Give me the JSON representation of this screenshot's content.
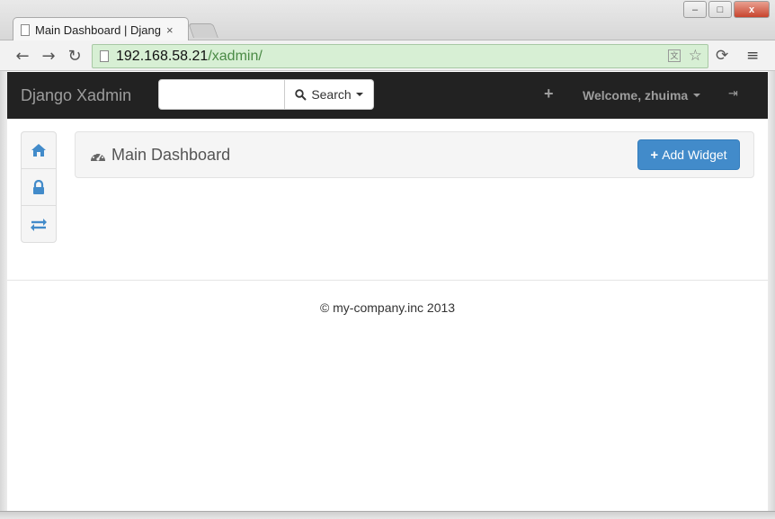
{
  "browser": {
    "tab_title": "Main Dashboard | Django Xadmin",
    "tab_close": "×",
    "url_host": "192.168.58.21",
    "url_path": "/xadmin/",
    "back_glyph": "←",
    "forward_glyph": "→",
    "reload_glyph": "↻",
    "star_glyph": "☆",
    "menu_glyph": "≡",
    "minimize_glyph": "–",
    "maximize_glyph": "□",
    "close_glyph": "x"
  },
  "navbar": {
    "brand": "Django Xadmin",
    "search_value": "",
    "search_label": "Search",
    "add_glyph": "+",
    "welcome": "Welcome, zhuima",
    "logout_glyph": "⇥"
  },
  "sidebar": {
    "items": [
      {
        "icon": "home-icon"
      },
      {
        "icon": "lock-icon"
      },
      {
        "icon": "exchange-icon"
      }
    ]
  },
  "dashboard": {
    "title": "Main Dashboard",
    "add_widget_label": "Add Widget"
  },
  "footer": {
    "text": "© my-company.inc 2013"
  },
  "colors": {
    "navbar_bg": "#222222",
    "primary": "#428bca",
    "icon_blue": "#428bca",
    "url_bg": "#d7efd4"
  }
}
